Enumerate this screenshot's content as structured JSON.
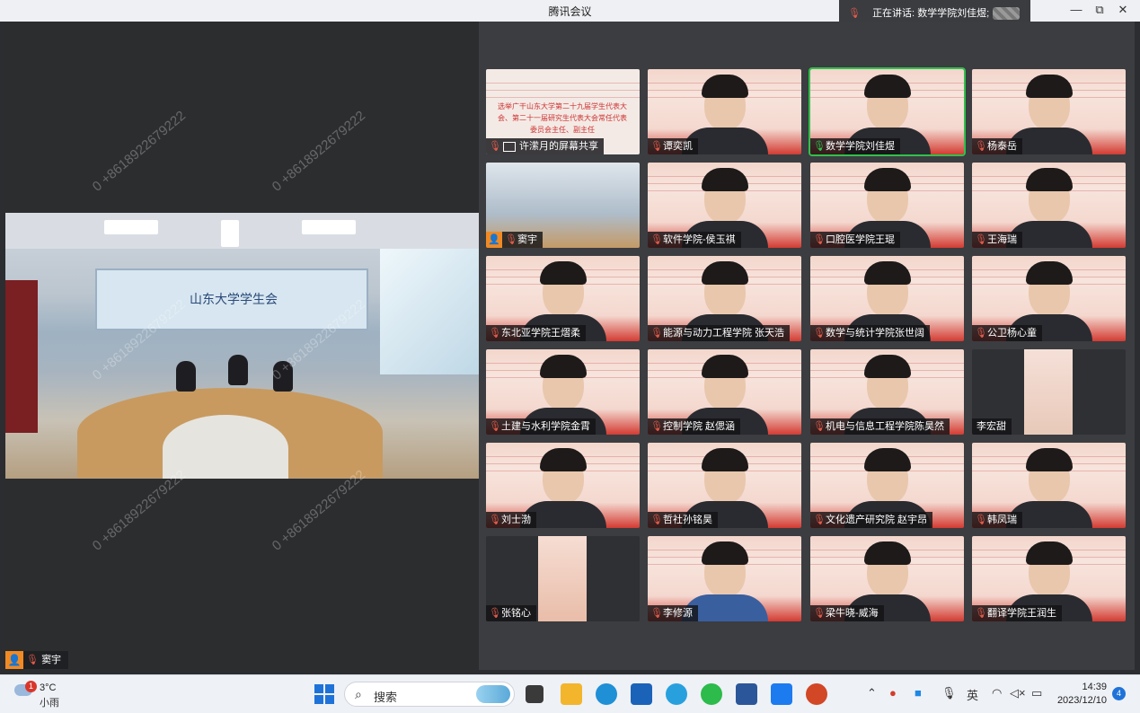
{
  "window": {
    "title": "腾讯会议",
    "speaking_prefix": "正在讲话:",
    "speaking_name": "数学学院刘佳煜;"
  },
  "window_controls": {
    "minimize": "—",
    "maximize": "⧉",
    "close": "✕"
  },
  "main_video": {
    "name": "窦宇",
    "logo_text": "山东大学学生会"
  },
  "watermark": "0 +8618922679222",
  "share_tile": {
    "label": "许潆月的屏幕共享",
    "slide_text": "选举广干山东大学第二十九届学生代表大会、第二十一届研究生代表大会常任代表委员会主任、副主任"
  },
  "participants": [
    {
      "name": "许潆月的屏幕共享"
    },
    {
      "name": "谭奕凯"
    },
    {
      "name": "数学学院刘佳煜"
    },
    {
      "name": "杨泰岳"
    },
    {
      "name": "窦宇"
    },
    {
      "name": "软件学院-侯玉祺"
    },
    {
      "name": "口腔医学院王琨"
    },
    {
      "name": "王海瑞"
    },
    {
      "name": "东北亚学院王熠柔"
    },
    {
      "name": "能源与动力工程学院 张天浩"
    },
    {
      "name": "数学与统计学院张世阔"
    },
    {
      "name": "公卫杨心童"
    },
    {
      "name": "土建与水利学院金霄"
    },
    {
      "name": "控制学院  赵偲涵"
    },
    {
      "name": "机电与信息工程学院陈昊然"
    },
    {
      "name": "李宏甜"
    },
    {
      "name": "刘士渤"
    },
    {
      "name": "哲社孙铭昊"
    },
    {
      "name": "文化遗产研究院 赵宇昂"
    },
    {
      "name": "韩凤瑞"
    },
    {
      "name": "张铭心"
    },
    {
      "name": "李修源"
    },
    {
      "name": "梁牛晓-威海"
    },
    {
      "name": "翻译学院王润生"
    }
  ],
  "taskbar": {
    "weather_badge": "1",
    "weather_temp": "3°C",
    "weather_condition": "小雨",
    "search_label": "搜索",
    "ime": "英",
    "time": "14:39",
    "date": "2023/12/10",
    "notification_count": "4"
  },
  "colors": {
    "speaking_border": "#31c04b",
    "muted_mic": "#e25b4a",
    "host_avatar": "#f08a24"
  }
}
